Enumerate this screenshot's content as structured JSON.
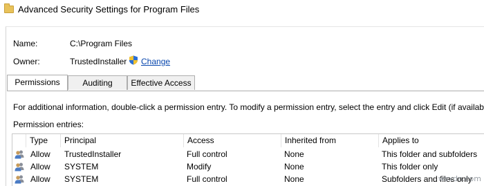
{
  "window": {
    "title": "Advanced Security Settings for Program Files"
  },
  "details": {
    "name_label": "Name:",
    "name_value": "C:\\Program Files",
    "owner_label": "Owner:",
    "owner_value": "TrustedInstaller",
    "change_label": "Change"
  },
  "tabs": [
    {
      "label": "Permissions",
      "active": true
    },
    {
      "label": "Auditing",
      "active": false
    },
    {
      "label": "Effective Access",
      "active": false
    }
  ],
  "info_text": "For additional information, double-click a permission entry. To modify a permission entry, select the entry and click Edit (if available).",
  "entries_label": "Permission entries:",
  "grid": {
    "columns": [
      "Type",
      "Principal",
      "Access",
      "Inherited from",
      "Applies to"
    ],
    "rows": [
      [
        "Allow",
        "TrustedInstaller",
        "Full control",
        "None",
        "This folder and subfolders"
      ],
      [
        "Allow",
        "SYSTEM",
        "Modify",
        "None",
        "This folder only"
      ],
      [
        "Allow",
        "SYSTEM",
        "Full control",
        "None",
        "Subfolders and files only"
      ]
    ]
  },
  "watermark": "wsxdn.com",
  "icons": {
    "window": "folder-icon",
    "change": "uac-shield-icon",
    "row": "user-group-icon"
  }
}
